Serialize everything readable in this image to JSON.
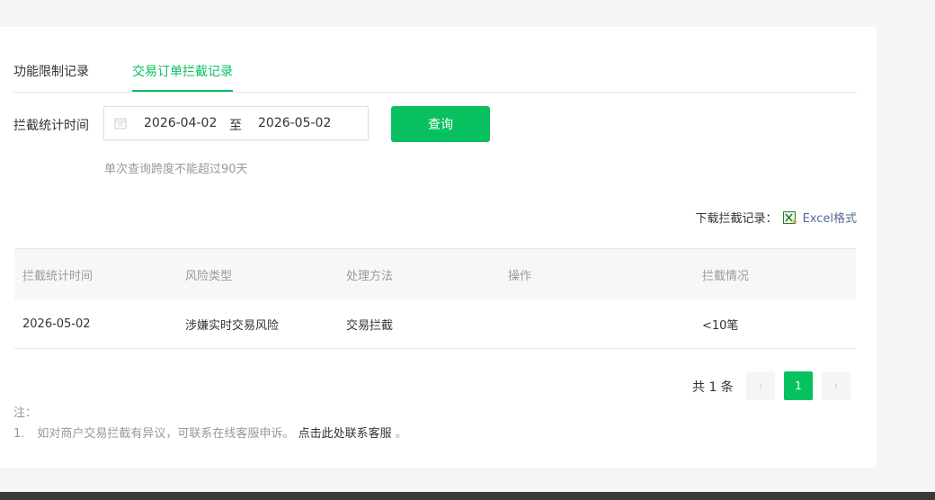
{
  "tabs": [
    {
      "label": "功能限制记录"
    },
    {
      "label": "交易订单拦截记录"
    }
  ],
  "filter": {
    "label": "拦截统计时间",
    "start_date": "2026-04-02",
    "separator": "至",
    "end_date": "2026-05-02",
    "query_button": "查询",
    "hint": "单次查询跨度不能超过90天"
  },
  "download": {
    "label": "下载拦截记录：",
    "excel_label": "Excel格式"
  },
  "table": {
    "headers": [
      "拦截统计时间",
      "风险类型",
      "处理方法",
      "操作",
      "拦截情况"
    ],
    "rows": [
      [
        "2026-05-02",
        "涉嫌实时交易风险",
        "交易拦截",
        "",
        "<10笔"
      ]
    ]
  },
  "pagination": {
    "total": "共 1 条",
    "current_page": "1",
    "prev_symbol": "‹",
    "next_symbol": "›"
  },
  "notes": {
    "title": "注：",
    "items": [
      {
        "num": "1.",
        "text": "如对商户交易拦截有异议，可联系在线客服申诉。",
        "link": "点击此处联系客服",
        "suffix": " 。"
      }
    ]
  },
  "colors": {
    "accent": "#07c160",
    "link": "#576b95"
  }
}
